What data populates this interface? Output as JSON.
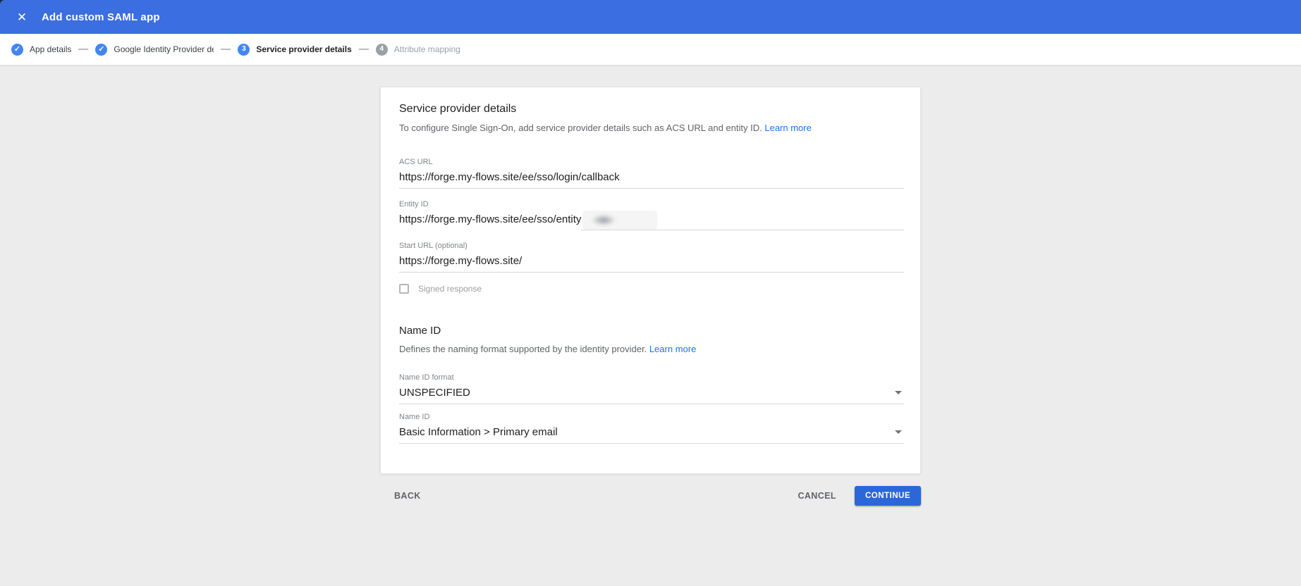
{
  "header": {
    "title": "Add custom SAML app"
  },
  "icons": {
    "close": "✕",
    "check": "✓"
  },
  "stepper": {
    "steps": [
      {
        "label": "App details",
        "state": "done"
      },
      {
        "label": "Google Identity Provider details",
        "state": "done"
      },
      {
        "label": "Service provider details",
        "state": "active",
        "number": "3"
      },
      {
        "label": "Attribute mapping",
        "state": "upcoming",
        "number": "4"
      }
    ]
  },
  "card": {
    "title": "Service provider details",
    "description": "To configure Single Sign-On, add service provider details such as ACS URL and entity ID.",
    "learn_more": "Learn more",
    "fields": {
      "acs_url": {
        "label": "ACS URL",
        "value": "https://forge.my-flows.site/ee/sso/login/callback"
      },
      "entity_id": {
        "label": "Entity ID",
        "value": "https://forge.my-flows.site/ee/sso/entity",
        "redacted": true
      },
      "start_url": {
        "label": "Start URL (optional)",
        "value": "https://forge.my-flows.site/"
      },
      "signed_response": {
        "label": "Signed response",
        "checked": false
      }
    },
    "name_id_section": {
      "title": "Name ID",
      "description": "Defines the naming format supported by the identity provider.",
      "learn_more": "Learn more",
      "format": {
        "label": "Name ID format",
        "value": "UNSPECIFIED"
      },
      "name_id": {
        "label": "Name ID",
        "value": "Basic Information > Primary email"
      }
    }
  },
  "footer": {
    "back": "BACK",
    "cancel": "CANCEL",
    "continue": "CONTINUE"
  },
  "colors": {
    "header_blue": "#3b6ee0",
    "step_blue": "#4285f4",
    "step_gray": "#9aa0a6",
    "link_blue": "#1a73e8",
    "continue_blue": "#2b67d9",
    "page_background": "#ececec"
  }
}
